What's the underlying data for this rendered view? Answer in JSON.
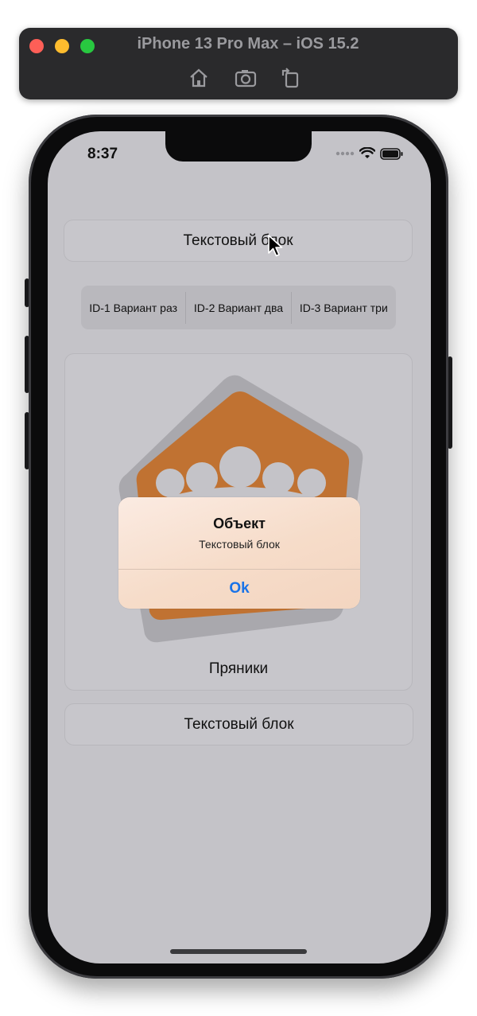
{
  "simulator": {
    "title": "iPhone 13 Pro Max – iOS 15.2",
    "tools": [
      "home-icon",
      "screenshot-icon",
      "rotate-icon"
    ]
  },
  "status_bar": {
    "time": "8:37"
  },
  "top_button": {
    "label": "Текстовый блок"
  },
  "segmented": {
    "items": [
      "ID-1 Вариант раз",
      "ID-2 Вариант два",
      "ID-3 Вариант три"
    ]
  },
  "card": {
    "label": "Пряники",
    "image": "gingerbread-hexagon-logo"
  },
  "bottom_button": {
    "label": "Текстовый блок"
  },
  "alert": {
    "title": "Объект",
    "message": "Текстовый блок",
    "ok_label": "Ok"
  },
  "colors": {
    "screen_bg": "#c4c3c8",
    "logo_orange": "#c07232",
    "alert_button": "#1a73e8"
  }
}
